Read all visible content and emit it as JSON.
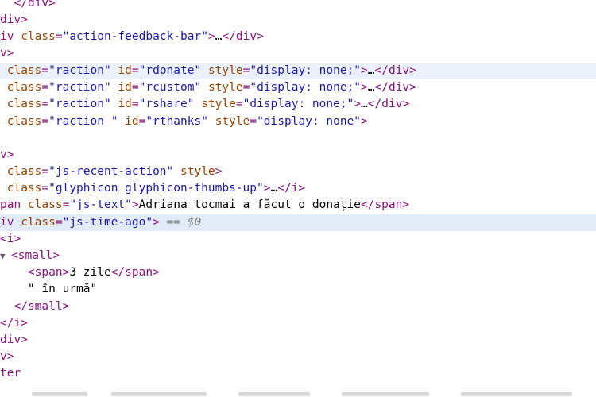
{
  "lines": [
    {
      "parts": [
        {
          "c": "punct",
          "t": "</"
        },
        {
          "c": "tag",
          "t": "div"
        },
        {
          "c": "punct",
          "t": ">"
        }
      ],
      "indent": "  "
    },
    {
      "parts": [
        {
          "c": "tag",
          "t": "div"
        },
        {
          "c": "punct",
          "t": ">"
        }
      ],
      "indent": ""
    },
    {
      "parts": [
        {
          "c": "tag",
          "t": "iv "
        },
        {
          "c": "attr",
          "t": "class"
        },
        {
          "c": "punct",
          "t": "="
        },
        {
          "c": "val",
          "t": "\"action-feedback-bar\""
        },
        {
          "c": "punct",
          "t": ">"
        },
        {
          "c": "txt",
          "t": "…"
        },
        {
          "c": "punct",
          "t": "</"
        },
        {
          "c": "tag",
          "t": "div"
        },
        {
          "c": "punct",
          "t": ">"
        }
      ],
      "indent": ""
    },
    {
      "parts": [
        {
          "c": "tag",
          "t": "v"
        },
        {
          "c": "punct",
          "t": ">"
        }
      ],
      "indent": ""
    },
    {
      "parts": [
        {
          "c": "attr",
          "t": "class"
        },
        {
          "c": "punct",
          "t": "="
        },
        {
          "c": "val",
          "t": "\"raction\""
        },
        {
          "c": "txt",
          "t": " "
        },
        {
          "c": "attr",
          "t": "id"
        },
        {
          "c": "punct",
          "t": "="
        },
        {
          "c": "val",
          "t": "\"rdonate\""
        },
        {
          "c": "txt",
          "t": " "
        },
        {
          "c": "attr",
          "t": "style"
        },
        {
          "c": "punct",
          "t": "="
        },
        {
          "c": "val",
          "t": "\"display: none;\""
        },
        {
          "c": "punct",
          "t": ">"
        },
        {
          "c": "txt",
          "t": "…"
        },
        {
          "c": "punct",
          "t": "</"
        },
        {
          "c": "tag",
          "t": "div"
        },
        {
          "c": "punct",
          "t": ">"
        }
      ],
      "indent": " ",
      "hl": true
    },
    {
      "parts": [
        {
          "c": "attr",
          "t": "class"
        },
        {
          "c": "punct",
          "t": "="
        },
        {
          "c": "val",
          "t": "\"raction\""
        },
        {
          "c": "txt",
          "t": " "
        },
        {
          "c": "attr",
          "t": "id"
        },
        {
          "c": "punct",
          "t": "="
        },
        {
          "c": "val",
          "t": "\"rcustom\""
        },
        {
          "c": "txt",
          "t": " "
        },
        {
          "c": "attr",
          "t": "style"
        },
        {
          "c": "punct",
          "t": "="
        },
        {
          "c": "val",
          "t": "\"display: none;\""
        },
        {
          "c": "punct",
          "t": ">"
        },
        {
          "c": "txt",
          "t": "…"
        },
        {
          "c": "punct",
          "t": "</"
        },
        {
          "c": "tag",
          "t": "div"
        },
        {
          "c": "punct",
          "t": ">"
        }
      ],
      "indent": " "
    },
    {
      "parts": [
        {
          "c": "attr",
          "t": "class"
        },
        {
          "c": "punct",
          "t": "="
        },
        {
          "c": "val",
          "t": "\"raction\""
        },
        {
          "c": "txt",
          "t": " "
        },
        {
          "c": "attr",
          "t": "id"
        },
        {
          "c": "punct",
          "t": "="
        },
        {
          "c": "val",
          "t": "\"rshare\""
        },
        {
          "c": "txt",
          "t": " "
        },
        {
          "c": "attr",
          "t": "style"
        },
        {
          "c": "punct",
          "t": "="
        },
        {
          "c": "val",
          "t": "\"display: none;\""
        },
        {
          "c": "punct",
          "t": ">"
        },
        {
          "c": "txt",
          "t": "…"
        },
        {
          "c": "punct",
          "t": "</"
        },
        {
          "c": "tag",
          "t": "div"
        },
        {
          "c": "punct",
          "t": ">"
        }
      ],
      "indent": " "
    },
    {
      "parts": [
        {
          "c": "attr",
          "t": "class"
        },
        {
          "c": "punct",
          "t": "="
        },
        {
          "c": "val",
          "t": "\"raction \""
        },
        {
          "c": "txt",
          "t": " "
        },
        {
          "c": "attr",
          "t": "id"
        },
        {
          "c": "punct",
          "t": "="
        },
        {
          "c": "val",
          "t": "\"rthanks\""
        },
        {
          "c": "txt",
          "t": " "
        },
        {
          "c": "attr",
          "t": "style"
        },
        {
          "c": "punct",
          "t": "="
        },
        {
          "c": "val",
          "t": "\"display: none\""
        },
        {
          "c": "punct",
          "t": ">"
        }
      ],
      "indent": " "
    },
    {
      "parts": [],
      "indent": ""
    },
    {
      "parts": [
        {
          "c": "tag",
          "t": "v"
        },
        {
          "c": "punct",
          "t": ">"
        }
      ],
      "indent": ""
    },
    {
      "parts": [
        {
          "c": "attr",
          "t": "class"
        },
        {
          "c": "punct",
          "t": "="
        },
        {
          "c": "val",
          "t": "\"js-recent-action\""
        },
        {
          "c": "txt",
          "t": " "
        },
        {
          "c": "attr",
          "t": "style"
        },
        {
          "c": "punct",
          "t": ">"
        }
      ],
      "indent": " "
    },
    {
      "parts": [
        {
          "c": "attr",
          "t": "class"
        },
        {
          "c": "punct",
          "t": "="
        },
        {
          "c": "val",
          "t": "\"glyphicon glyphicon-thumbs-up\""
        },
        {
          "c": "punct",
          "t": ">"
        },
        {
          "c": "txt",
          "t": "…"
        },
        {
          "c": "punct",
          "t": "</"
        },
        {
          "c": "tag",
          "t": "i"
        },
        {
          "c": "punct",
          "t": ">"
        }
      ],
      "indent": " "
    },
    {
      "parts": [
        {
          "c": "tag",
          "t": "pan "
        },
        {
          "c": "attr",
          "t": "class"
        },
        {
          "c": "punct",
          "t": "="
        },
        {
          "c": "val",
          "t": "\"js-text\""
        },
        {
          "c": "punct",
          "t": ">"
        },
        {
          "c": "txt",
          "t": "Adriana tocmai a făcut o donație"
        },
        {
          "c": "punct",
          "t": "</"
        },
        {
          "c": "tag",
          "t": "span"
        },
        {
          "c": "punct",
          "t": ">"
        }
      ],
      "indent": ""
    },
    {
      "parts": [
        {
          "c": "tag",
          "t": "iv "
        },
        {
          "c": "attr",
          "t": "class"
        },
        {
          "c": "punct",
          "t": "="
        },
        {
          "c": "val",
          "t": "\"js-time-ago\""
        },
        {
          "c": "punct",
          "t": ">"
        },
        {
          "c": "txt",
          "t": " "
        },
        {
          "c": "dim",
          "t": "=="
        },
        {
          "c": "txt",
          "t": " "
        },
        {
          "c": "var",
          "t": "$0"
        }
      ],
      "indent": "",
      "hl": true
    },
    {
      "parts": [
        {
          "c": "punct",
          "t": "<"
        },
        {
          "c": "tag",
          "t": "i"
        },
        {
          "c": "punct",
          "t": ">"
        }
      ],
      "indent": ""
    },
    {
      "parts": [
        {
          "c": "punct",
          "t": "<"
        },
        {
          "c": "tag",
          "t": "small"
        },
        {
          "c": "punct",
          "t": ">"
        }
      ],
      "indent": "",
      "tri": "▼"
    },
    {
      "parts": [
        {
          "c": "punct",
          "t": "<"
        },
        {
          "c": "tag",
          "t": "span"
        },
        {
          "c": "punct",
          "t": ">"
        },
        {
          "c": "txt",
          "t": "3 zile"
        },
        {
          "c": "punct",
          "t": "</"
        },
        {
          "c": "tag",
          "t": "span"
        },
        {
          "c": "punct",
          "t": ">"
        }
      ],
      "indent": "    "
    },
    {
      "parts": [
        {
          "c": "txt",
          "t": "\" în urmă\""
        }
      ],
      "indent": "    "
    },
    {
      "parts": [
        {
          "c": "punct",
          "t": "</"
        },
        {
          "c": "tag",
          "t": "small"
        },
        {
          "c": "punct",
          "t": ">"
        }
      ],
      "indent": "  "
    },
    {
      "parts": [
        {
          "c": "punct",
          "t": "</"
        },
        {
          "c": "tag",
          "t": "i"
        },
        {
          "c": "punct",
          "t": ">"
        }
      ],
      "indent": ""
    },
    {
      "parts": [
        {
          "c": "tag",
          "t": "div"
        },
        {
          "c": "punct",
          "t": ">"
        }
      ],
      "indent": ""
    },
    {
      "parts": [
        {
          "c": "tag",
          "t": "v"
        },
        {
          "c": "punct",
          "t": ">"
        }
      ],
      "indent": ""
    },
    {
      "parts": [
        {
          "c": "tag",
          "t": "ter"
        }
      ],
      "indent": ""
    }
  ]
}
